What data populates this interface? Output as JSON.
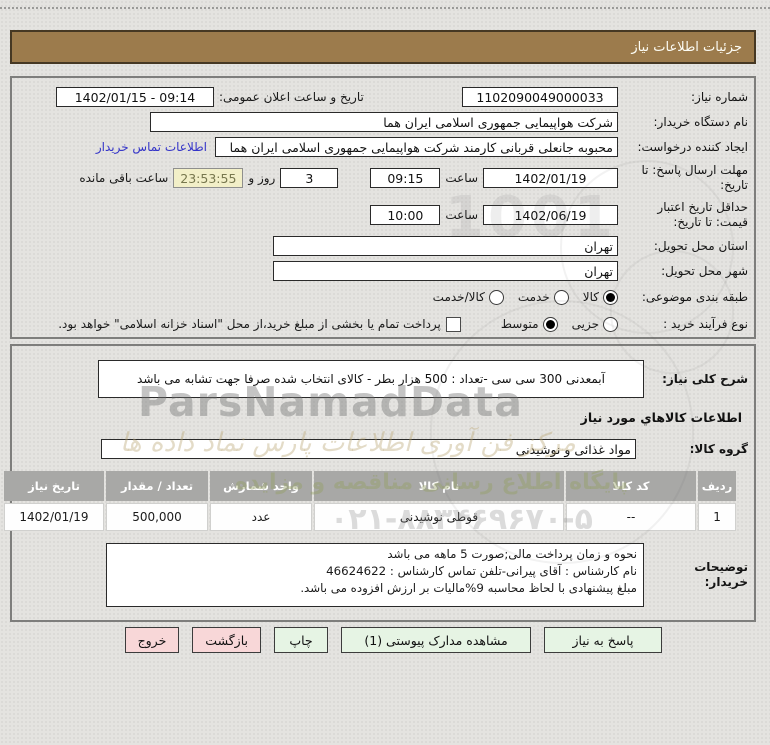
{
  "header": {
    "title": "جزئیات اطلاعات نیاز"
  },
  "info": {
    "need_number_label": "شماره نیاز:",
    "need_number": "1102090049000033",
    "announce_label": "تاریخ و ساعت اعلان عمومی:",
    "announce_value": "1402/01/15 - 09:14",
    "buyer_org_label": "نام دستگاه خریدار:",
    "buyer_org": "شرکت هواپیمایی جمهوری اسلامی ایران هما",
    "creator_label": "ایجاد کننده درخواست:",
    "creator": "محبوبه جانعلی قربانی کارمند شرکت هواپیمایی جمهوری اسلامی ایران هما",
    "contact_link": "اطلاعات تماس خریدار",
    "deadline_label": "مهلت ارسال پاسخ: تا تاریخ:",
    "deadline_date": "1402/01/19",
    "hour_label": "ساعت",
    "deadline_time": "09:15",
    "days_remaining": "3",
    "days_and_label": "روز و",
    "time_remaining": "23:53:55",
    "remaining_label": "ساعت باقی مانده",
    "validity_label": "حداقل تاریخ اعتبار قیمت: تا تاریخ:",
    "validity_date": "1402/06/19",
    "validity_time": "10:00",
    "province_label": "استان محل تحویل:",
    "province": "تهران",
    "city_label": "شهر محل تحویل:",
    "city": "تهران",
    "classification_label": "طبقه بندی موضوعی:",
    "radio_goods": "کالا",
    "radio_service": "خدمت",
    "radio_goods_service": "کالا/خدمت",
    "process_label": "نوع فرآیند خرید :",
    "radio_partial": "جزیی",
    "radio_medium": "متوسط",
    "treasury_checkbox_label": "پرداخت تمام یا بخشی از مبلغ خرید،از محل \"اسناد خزانه اسلامی\" خواهد بود."
  },
  "need": {
    "desc_label": "شرح کلی نیاز:",
    "desc": "آبمعدنی 300 سی سی -تعداد : 500 هزار بطر - کالای انتخاب شده صرفا جهت تشابه می باشد",
    "goods_heading": "اطلاعات کالاهاي مورد نیاز",
    "group_label": "گروه کالا:",
    "group": "مواد غذائی و نوشیدنی"
  },
  "table": {
    "headers": [
      "ردیف",
      "کد کالا",
      "نام کالا",
      "واحد شمارش",
      "تعداد / مقدار",
      "تاریخ نیاز"
    ],
    "rows": [
      [
        "1",
        "--",
        "قوطی نوشیدنی",
        "عدد",
        "500,000",
        "1402/01/19"
      ]
    ]
  },
  "notes": {
    "label": "توضیحات خریدار:",
    "line1": "نحوه و زمان پرداخت مالی;صورت 5 ماهه می باشد",
    "line2": "نام کارشناس : آقای پیرانی-تلفن تماس کارشناس : 46624622",
    "line3": "مبلغ پیشنهادی با لحاظ محاسبه 9%مالیات بر ارزش افزوده می باشد."
  },
  "buttons": [
    {
      "label": "پاسخ به نیاز",
      "type": "green"
    },
    {
      "label": "مشاهده مدارک پیوستی (1)",
      "type": "green"
    },
    {
      "label": "چاپ",
      "type": "green"
    },
    {
      "label": "بازگشت",
      "type": "red"
    },
    {
      "label": "خروج",
      "type": "red"
    }
  ],
  "watermarks": {
    "brand": "ParsNamadData",
    "line1": "مرکز فن آوری اطلاعات پارس نماد داده ها",
    "line2": "پایگاه اطلاع رسانی مناقصه و مزایده",
    "phone": "۰۲۱-۸۸۳۴۶۹۶۷۰-۵",
    "digits": "1001"
  },
  "colors": {
    "title_bar": "#9c7b4c",
    "button_green": "#e6f4e4",
    "button_red": "#f8d7d8",
    "countdown_yellow": "#f2efc8",
    "link_blue": "#3434c8",
    "table_header": "#a8a8a6"
  }
}
